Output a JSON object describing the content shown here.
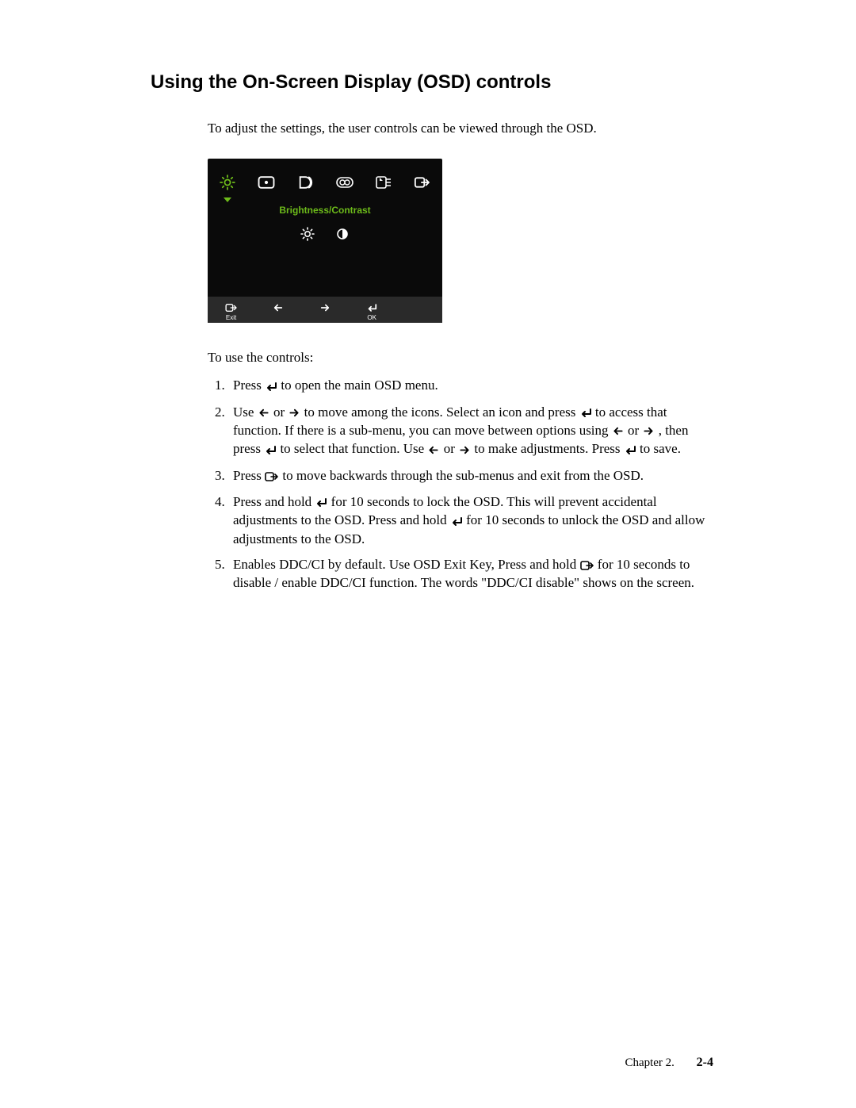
{
  "title": "Using the On-Screen Display (OSD) controls",
  "intro": "To adjust the settings,  the user controls can be viewed through the OSD.",
  "osd": {
    "label": "Brightness/Contrast",
    "bottom": {
      "exit": "Exit",
      "ok": "OK"
    }
  },
  "subhead": "To use the controls:",
  "steps": {
    "s1a": "Press ",
    "s1b": " to open the main OSD menu.",
    "s2a": "Use ",
    "s2b": " or ",
    "s2c": " to move among the icons. Select an icon and press  ",
    "s2d": " to access that function. If there is a sub-menu, you can move between options using  ",
    "s2e": " or  ",
    "s2f": " , then press  ",
    "s2g": " to select that function. Use ",
    "s2h": " or ",
    "s2i": " to make adjustments. Press ",
    "s2j": " to save.",
    "s3a": "Press ",
    "s3b": " to move backwards through the sub-menus and exit from the OSD.",
    "s4a": "Press and hold  ",
    "s4b": "  for 10 seconds to lock the OSD. This will prevent accidental adjustments to the OSD. Press and hold ",
    "s4c": "  for 10 seconds to unlock the OSD and allow adjustments to the OSD.",
    "s5a": "Enables DDC/CI by default. Use OSD Exit Key,  Press and hold ",
    "s5b": " for 10 seconds to disable / enable DDC/CI function. The words \"DDC/CI disable\" shows on the screen."
  },
  "footer": {
    "chapter": "Chapter 2.",
    "page": "2-4"
  }
}
